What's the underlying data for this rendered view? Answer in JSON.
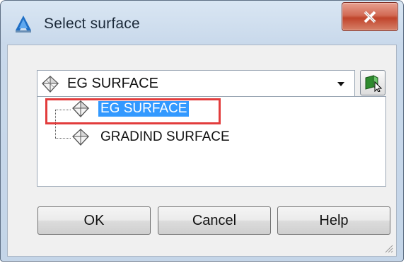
{
  "window": {
    "title": "Select surface",
    "close_symbol": "X"
  },
  "combo": {
    "icon": "surface-icon",
    "value": "EG SURFACE"
  },
  "tree": {
    "items": [
      {
        "label": "EG SURFACE",
        "icon": "surface-icon",
        "selected": true
      },
      {
        "label": "GRADIND SURFACE",
        "icon": "surface-icon",
        "selected": false
      }
    ]
  },
  "buttons": {
    "ok": "OK",
    "cancel": "Cancel",
    "help": "Help"
  },
  "colors": {
    "selection": "#3399ff",
    "highlight_box": "#e23c3c",
    "close_button": "#c0442b"
  }
}
